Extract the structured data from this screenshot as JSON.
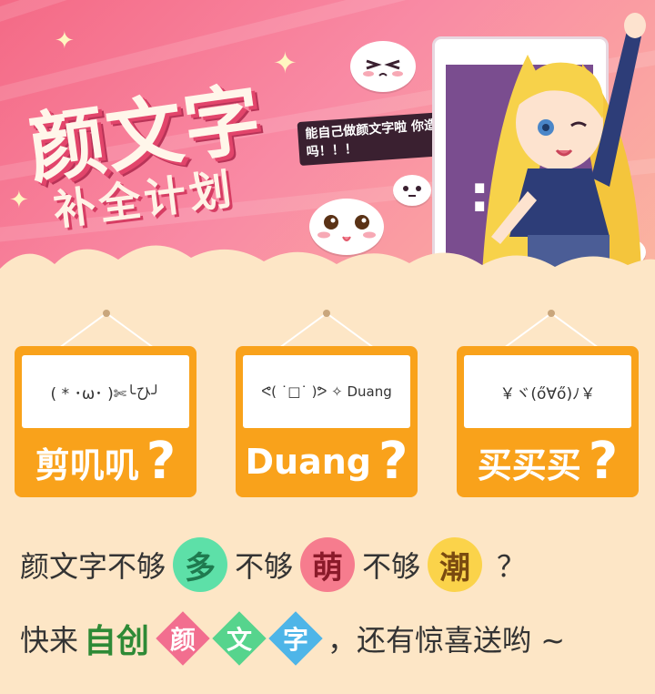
{
  "header": {
    "title": "颜文字",
    "subtitle": "补全计划",
    "bubble": "能自己做颜文字啦 你造吗！！！",
    "phone_face": ":-"
  },
  "cards": [
    {
      "emoticon": "( * ･ω･ )✄╰ひ╯",
      "label": "剪叽叽",
      "q": "?"
    },
    {
      "emoticon": "ᕙ( ˙□˙ )ᕗ ✧ Duang",
      "label": "Duang",
      "q": "?"
    },
    {
      "emoticon": "￥ヾ(ő∀ő)ﾉ￥",
      "label": "买买买",
      "q": "?"
    }
  ],
  "line1": {
    "prefix": "颜文字不够",
    "w1": "多",
    "mid1": "不够",
    "w2": "萌",
    "mid2": "不够",
    "w3": "潮",
    "end": "？"
  },
  "line2": {
    "prefix": "快来",
    "highlight": "自创",
    "d1": "颜",
    "d2": "文",
    "d3": "字",
    "end": "，还有惊喜送哟 ~"
  },
  "colors": {
    "card": "#f9a21b",
    "circle_green": "#5de0a8",
    "circle_pink": "#f67c8e",
    "circle_yellow": "#fbd34a",
    "diamond_pink": "#f26e8f",
    "diamond_green": "#56d48d",
    "diamond_blue": "#4eb5e8"
  }
}
